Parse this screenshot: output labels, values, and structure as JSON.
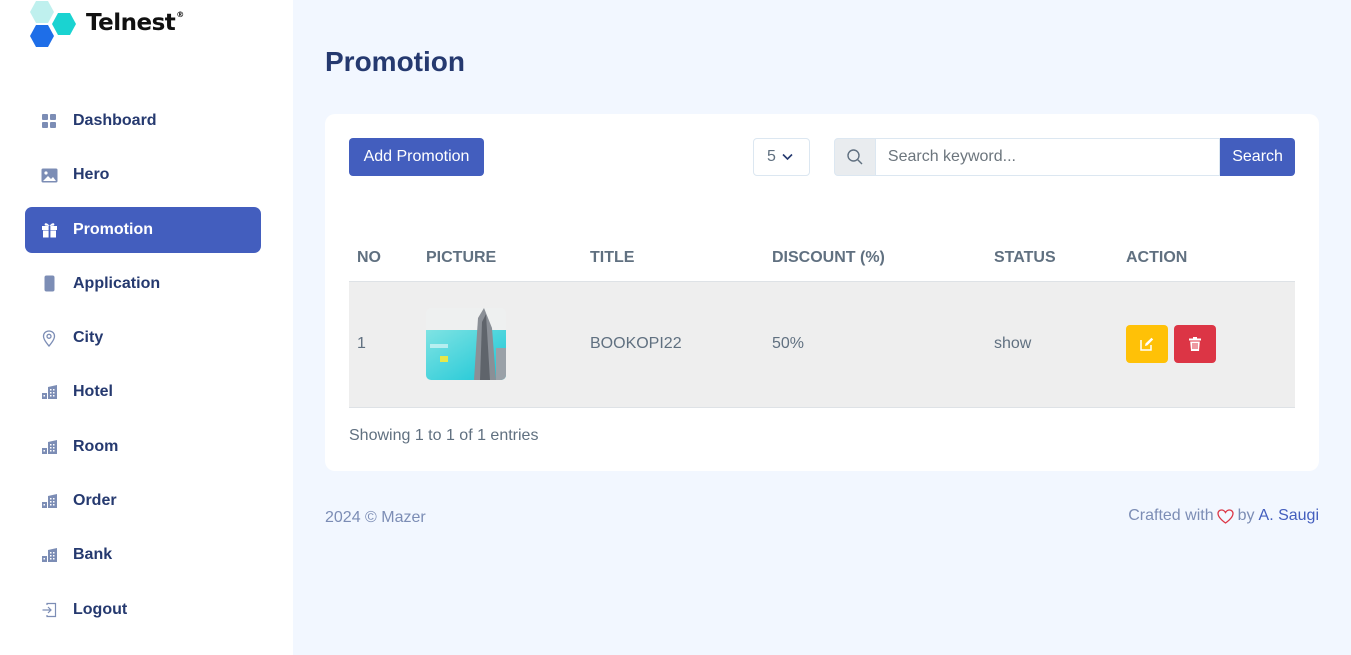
{
  "brand": {
    "name": "Telnest",
    "mark": "®"
  },
  "sidebar": {
    "items": [
      {
        "label": "Dashboard",
        "icon": "grid-icon"
      },
      {
        "label": "Hero",
        "icon": "image-icon"
      },
      {
        "label": "Promotion",
        "icon": "gift-icon",
        "active": true
      },
      {
        "label": "Application",
        "icon": "phone-icon"
      },
      {
        "label": "City",
        "icon": "map-pin-icon"
      },
      {
        "label": "Hotel",
        "icon": "building-icon"
      },
      {
        "label": "Room",
        "icon": "building-icon"
      },
      {
        "label": "Order",
        "icon": "building-icon"
      },
      {
        "label": "Bank",
        "icon": "building-icon"
      },
      {
        "label": "Logout",
        "icon": "logout-icon"
      }
    ]
  },
  "page": {
    "title": "Promotion"
  },
  "toolbar": {
    "add_label": "Add Promotion",
    "per_page": "5",
    "search_placeholder": "Search keyword...",
    "search_label": "Search"
  },
  "table": {
    "headers": [
      "NO",
      "PICTURE",
      "TITLE",
      "DISCOUNT (%)",
      "STATUS",
      "ACTION"
    ],
    "rows": [
      {
        "no": "1",
        "title": "BOOKOPI22",
        "discount": "50%",
        "status": "show"
      }
    ]
  },
  "entries_text": "Showing 1 to 1 of 1 entries",
  "footer": {
    "left": "2024 © Mazer",
    "crafted": "Crafted with",
    "by": "by",
    "author": "A. Saugi"
  },
  "colors": {
    "primary": "#435ebe",
    "edit": "#ffc107",
    "delete": "#dc3545",
    "background": "#f2f7ff"
  }
}
